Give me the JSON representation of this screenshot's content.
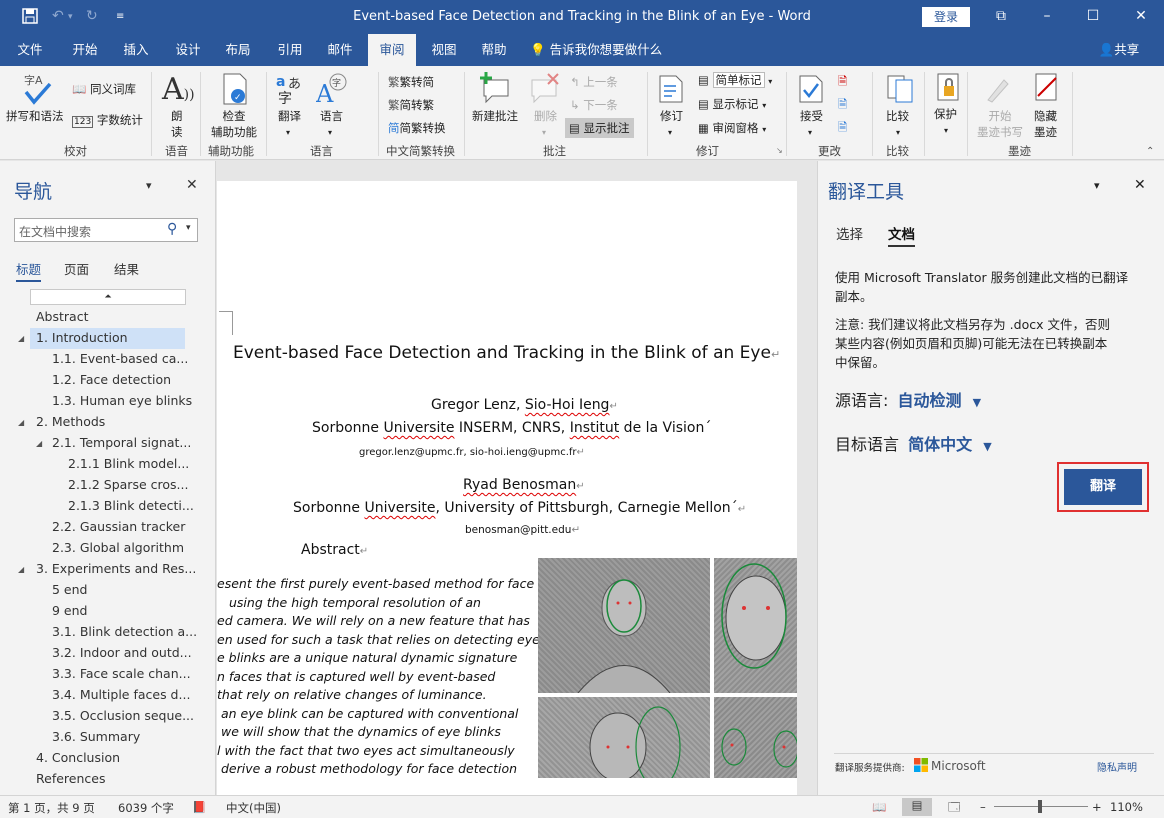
{
  "window": {
    "title": "Event-based Face Detection and Tracking in the Blink of an Eye  -  Word",
    "login_label": "登录"
  },
  "tabs": [
    "文件",
    "开始",
    "插入",
    "设计",
    "布局",
    "引用",
    "邮件",
    "审阅",
    "视图",
    "帮助"
  ],
  "tell_me": "告诉我你想要做什么",
  "share": "共享",
  "ribbon": {
    "spell": "拼写和语法",
    "thesaurus": "同义词库",
    "wordcount": "字数统计",
    "group_proofing": "校对",
    "read_aloud": [
      "朗",
      "读"
    ],
    "group_speech": "语音",
    "check_accessibility": [
      "检查",
      "辅助功能"
    ],
    "group_accessibility": "辅助功能",
    "translate": "翻译",
    "language": "语言",
    "group_language": "语言",
    "trad_to_simp": "繁转简",
    "simp_to_trad": "简转繁",
    "conversion": "简繁转换",
    "group_chinese": "中文简繁转换",
    "new_comment": "新建批注",
    "delete": "删除",
    "previous": "上一条",
    "next": "下一条",
    "show_comments": "显示批注",
    "group_comments": "批注",
    "track": "修订",
    "simple_markup": "简单标记",
    "show_markup": "显示标记",
    "reviewing_pane": "审阅窗格",
    "group_tracking": "修订",
    "accept": "接受",
    "group_changes": "更改",
    "compare": "比较",
    "group_compare": "比较",
    "protect": "保护",
    "start_ink": [
      "开始",
      "墨迹书写"
    ],
    "hide_ink": [
      "隐藏",
      "墨迹"
    ],
    "group_ink": "墨迹"
  },
  "nav": {
    "title": "导航",
    "search_placeholder": "在文档中搜索",
    "tabs": [
      "标题",
      "页面",
      "结果"
    ],
    "items": [
      "Abstract",
      "1. Introduction",
      "1.1. Event-based ca...",
      "1.2. Face detection",
      "1.3. Human eye blinks",
      "2. Methods",
      "2.1. Temporal signat...",
      "2.1.1 Blink model...",
      "2.1.2 Sparse cros...",
      "2.1.3 Blink detecti...",
      "2.2. Gaussian tracker",
      "2.3. Global algorithm",
      "3. Experiments and Res...",
      "5 end",
      "9 end",
      "3.1. Blink detection a...",
      "3.2. Indoor and outd...",
      "3.3. Face scale chan...",
      "3.4. Multiple faces d...",
      "3.5. Occlusion seque...",
      "3.6. Summary",
      "4. Conclusion",
      "References"
    ]
  },
  "document": {
    "title": "Event-based Face Detection and Tracking in the Blink of an Eye",
    "authors1": {
      "a": "Gregor Lenz, ",
      "b": "Sio-Hoi Ieng"
    },
    "affil1": {
      "a": "Sorbonne ",
      "b": "Universite",
      "c": " INSERM, CNRS, ",
      "d": "Institut",
      "e": " de la Vision´"
    },
    "email1": "gregor.lenz@upmc.fr, sio-hoi.ieng@upmc.fr",
    "author2": "Ryad Benosman",
    "affil2": {
      "a": "Sorbonne ",
      "b": "Universite",
      "c": ", University of Pittsburgh, Carnegie Mellon´"
    },
    "email2": "benosman@pitt.edu",
    "abstract_heading": "Abstract",
    "abstract_lines": [
      "esent the first purely event-based method for face",
      "using   the   high   temporal   resolution   of   an",
      "ed camera. We will rely on a new feature that has",
      "en used for such a task that relies on detecting eye",
      "e blinks are a unique natural dynamic signature",
      "n  faces  that  is  captured  well  by  event-based",
      "that  rely  on  relative  changes  of  luminance.",
      "an eye blink can be captured with conventional",
      "we  will  show  that  the  dynamics  of  eye  blinks",
      "l with the fact that two eyes act simultaneously",
      "derive a robust methodology for face detection"
    ]
  },
  "translator": {
    "title": "翻译工具",
    "tabs": [
      "选择",
      "文档"
    ],
    "desc": [
      "使用 Microsoft Translator 服务创建此文档的已翻译",
      "副本。"
    ],
    "note": [
      "注意: 我们建议将此文档另存为 .docx 文件，否则",
      "某些内容(例如页眉和页脚)可能无法在已转换副本",
      "中保留。"
    ],
    "source_label": "源语言:",
    "source_value": "自动检测",
    "target_label": "目标语言",
    "target_value": "简体中文",
    "translate_button": "翻译",
    "provider": "翻译服务提供商:",
    "microsoft": "Microsoft",
    "privacy": "隐私声明"
  },
  "status": {
    "page": "第 1 页，共 9 页",
    "words": "6039 个字",
    "lang": "中文(中国)",
    "zoom": "110%"
  },
  "colors": {
    "accent": "#2b579a",
    "red_highlight": "#e03030"
  }
}
